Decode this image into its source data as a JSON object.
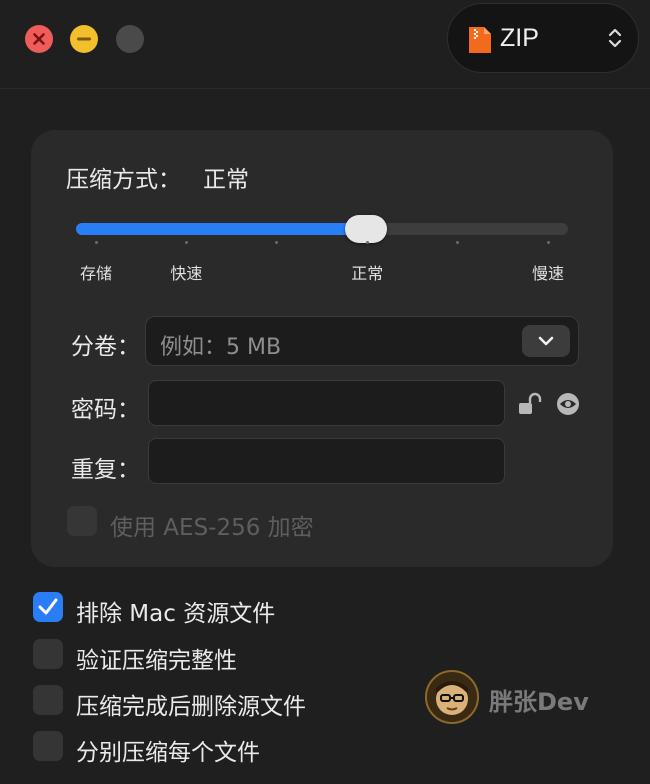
{
  "window": {
    "format_select": {
      "value": "ZIP",
      "icon": "zip-file-icon"
    }
  },
  "compression": {
    "method_label": "压缩方式：",
    "method_value": "正常",
    "slider": {
      "value_fraction": 0.59,
      "ticks": [
        "存储",
        "快速",
        "",
        "正常",
        "",
        "慢速"
      ]
    }
  },
  "split": {
    "label": "分卷：",
    "placeholder": "例如：5 MB"
  },
  "password": {
    "label": "密码：",
    "value": ""
  },
  "repeat": {
    "label": "重复：",
    "value": ""
  },
  "aes": {
    "label": "使用 AES-256 加密",
    "checked": false
  },
  "options": [
    {
      "label": "排除 Mac 资源文件",
      "checked": true
    },
    {
      "label": "验证压缩完整性",
      "checked": false
    },
    {
      "label": "压缩完成后删除源文件",
      "checked": false
    },
    {
      "label": "分别压缩每个文件",
      "checked": false
    }
  ],
  "watermark": {
    "text": "胖张Dev"
  },
  "colors": {
    "accent": "#2a7ef5",
    "close": "#ee5d59",
    "minimize": "#f3bf2c",
    "zip_icon": "#f26b1d"
  }
}
